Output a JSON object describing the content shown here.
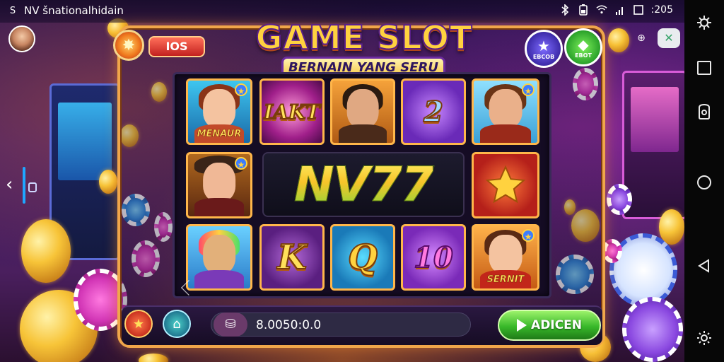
{
  "status_bar": {
    "app_glyph": "S",
    "app_name": "NV šnationalhidain",
    "bluetooth_icon": "bluetooth-icon",
    "battery_icon": "battery-icon",
    "wifi_icon": "wifi-icon",
    "clock_text": ":205"
  },
  "header": {
    "level_label": "IOS",
    "title": "GAME SLOT",
    "subtitle": "BERNAIN YANG SERU",
    "star_badge_caption": "EBCOB",
    "bet_badge_caption": "EBOT"
  },
  "reels": {
    "r1c1_name": "MENAUR",
    "r1c2_label": "IAKT",
    "r1c4_label": "2",
    "banner": "NV77",
    "r3c2_label": "K",
    "r3c3_label": "Q",
    "r3c4_label": "10",
    "r3c5_name": "SERNIT"
  },
  "footer": {
    "balance": "8.0050:0.0",
    "spin_label": "ADICEN"
  },
  "colors": {
    "frame_accent": "#f0a64a",
    "spin_green": "#38b82a",
    "title_gold": "#ffd23f",
    "nav_background": "#070707"
  }
}
